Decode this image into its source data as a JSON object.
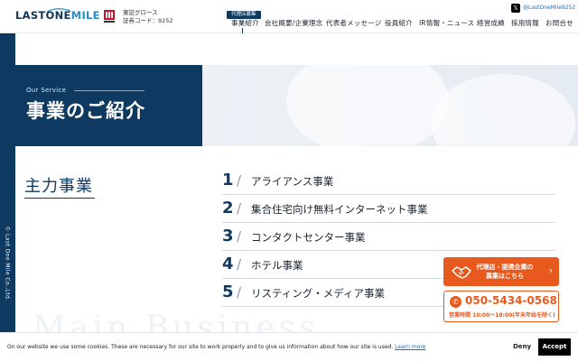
{
  "header": {
    "logo_text_main": "LASTONE",
    "logo_text_sub": "MILE",
    "listing": {
      "market": "東証グロース",
      "code": "証券コード：9252"
    },
    "nav": [
      {
        "label": "事業紹介",
        "badge": "代理店募集"
      },
      {
        "label": "会社概要/企業理念"
      },
      {
        "label": "代表者メッセージ"
      },
      {
        "label": "役員紹介"
      },
      {
        "label": "IR情報・ニュース"
      },
      {
        "label": "経営成績"
      },
      {
        "label": "採用情報"
      },
      {
        "label": "お問合せ"
      }
    ],
    "x_handle": "@LastOneMile9252"
  },
  "side": {
    "vertical_text": "© Last One Mile Co.,Ltd."
  },
  "hero": {
    "eyebrow": "Our Service",
    "title": "事業のご紹介"
  },
  "main": {
    "section_title": "主力事業",
    "ghost_text": "Main Business",
    "services": [
      {
        "num": "1",
        "label": "アライアンス事業"
      },
      {
        "num": "2",
        "label": "集合住宅向け無料インターネット事業"
      },
      {
        "num": "3",
        "label": "コンタクトセンター事業"
      },
      {
        "num": "4",
        "label": "ホテル事業"
      },
      {
        "num": "5",
        "label": "リスティング・メディア事業"
      }
    ]
  },
  "cta": {
    "agency_line1": "代理店・提携企業の",
    "agency_line2": "募集はこちら",
    "phone": "050-5434-0568",
    "hours": "営業時間 10:00～18:00(年末年始を除く)"
  },
  "cookie": {
    "message": "On our website we use some cookies. These are necessary for our site to work properly and to give us information about how our site is used.",
    "learn_more": "Learn more",
    "deny": "Deny",
    "accept": "Accept"
  },
  "colors": {
    "navy": "#0e3a61",
    "orange": "#e8591d"
  }
}
